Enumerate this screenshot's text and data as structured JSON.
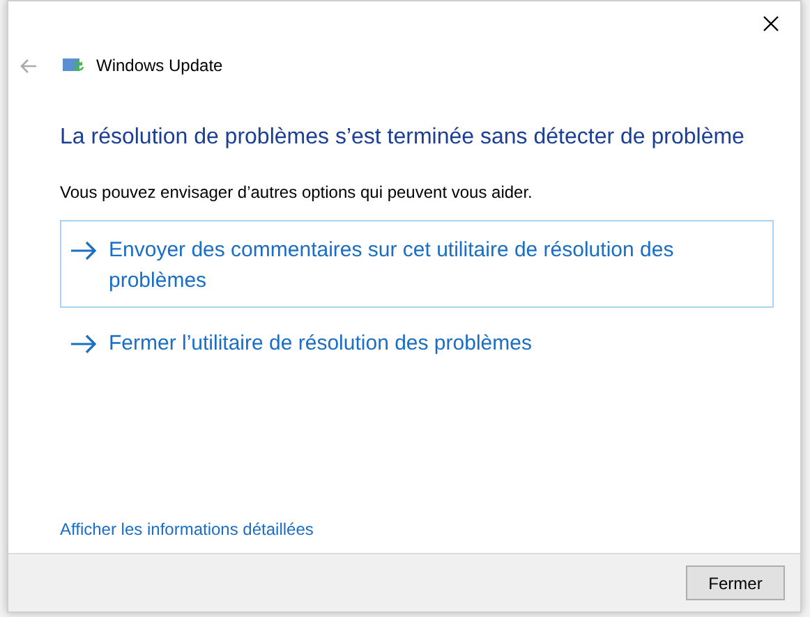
{
  "window": {
    "title": "Windows Update"
  },
  "heading": "La résolution de problèmes s’est terminée sans détecter de problème",
  "subtitle": "Vous pouvez envisager d’autres options qui peuvent vous aider.",
  "options": [
    {
      "label": "Envoyer des commentaires sur cet utilitaire de résolution des problèmes",
      "highlighted": true
    },
    {
      "label": "Fermer l’utilitaire de résolution des problèmes",
      "highlighted": false
    }
  ],
  "details_link": "Afficher les informations détaillées",
  "buttons": [
    "Fermer"
  ]
}
